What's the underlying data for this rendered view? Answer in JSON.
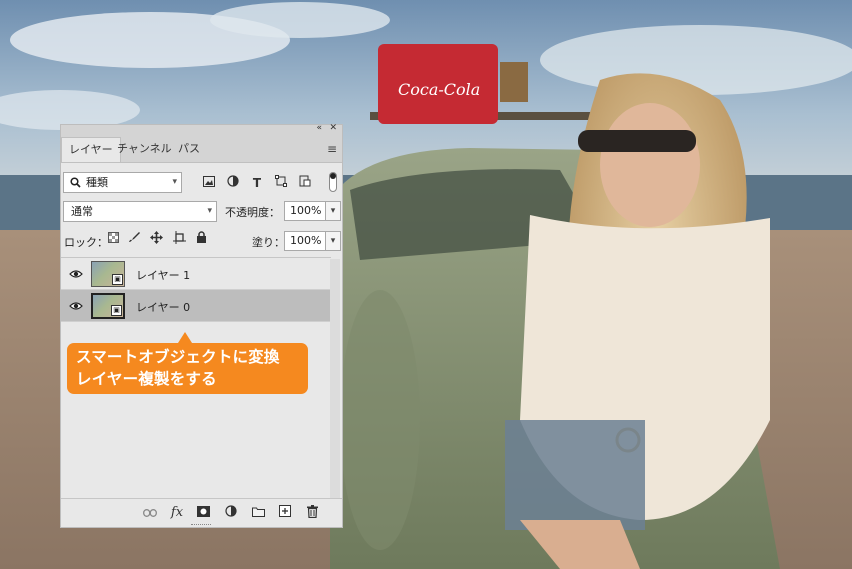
{
  "panel": {
    "collapse_glyph": "«",
    "close_glyph": "✕",
    "tabs": [
      {
        "label": "レイヤー",
        "active": true
      },
      {
        "label": "チャンネル",
        "active": false
      },
      {
        "label": "パス",
        "active": false
      }
    ],
    "menu_glyph": "≡",
    "filter": {
      "icon": "search-icon",
      "value": "種類"
    },
    "filter_icons": [
      "image-filter-icon",
      "adjustment-filter-icon",
      "type-filter-icon",
      "shape-filter-icon",
      "smart-object-filter-icon"
    ],
    "blend_mode": "通常",
    "opacity_label": "不透明度：",
    "opacity_value": "100%",
    "lock_label": "ロック：",
    "lock_icons": [
      "lock-transparent-icon",
      "lock-paint-icon",
      "lock-position-icon",
      "lock-artboard-icon",
      "lock-all-icon"
    ],
    "fill_label": "塗り：",
    "fill_value": "100%",
    "layers": [
      {
        "name": "レイヤー 1",
        "selected": false,
        "smart_object": true
      },
      {
        "name": "レイヤー 0",
        "selected": true,
        "smart_object": true
      }
    ],
    "bottom_icons": [
      "link-layers-icon",
      "fx-icon",
      "layer-mask-icon",
      "adjustment-layer-icon",
      "new-group-icon",
      "new-layer-icon",
      "delete-layer-icon"
    ]
  },
  "callout": {
    "line1": "スマートオブジェクトに変換",
    "line2": "レイヤー複製をする",
    "color": "#f5891f"
  }
}
